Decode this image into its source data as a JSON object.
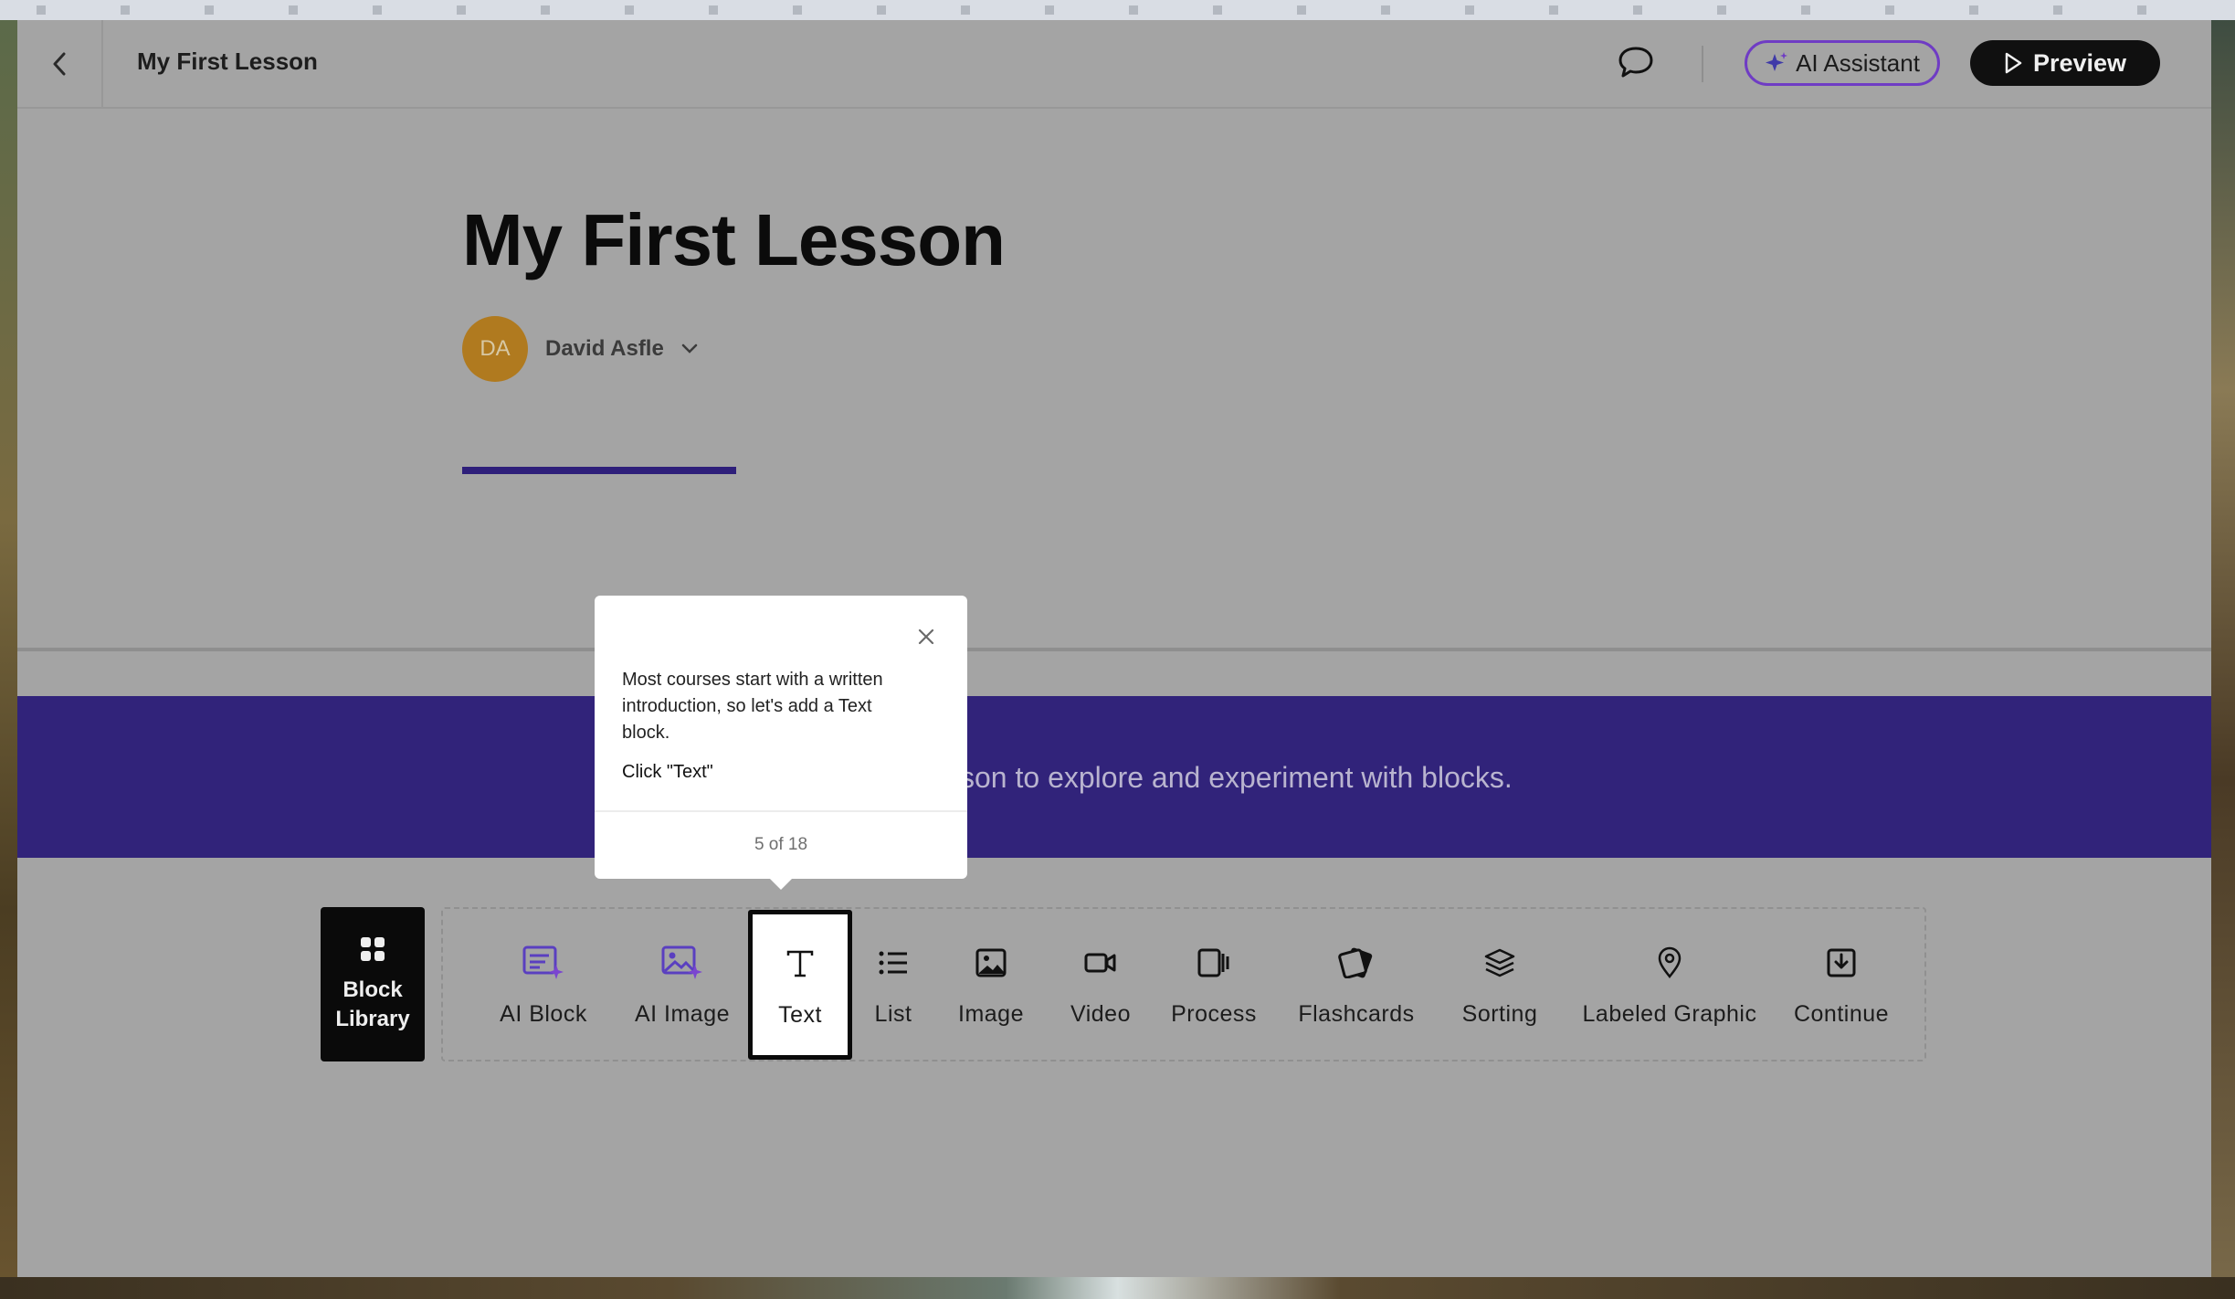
{
  "header": {
    "title": "My First Lesson",
    "ai_assistant_label": "AI Assistant",
    "preview_label": "Preview"
  },
  "lesson": {
    "title": "My First Lesson",
    "author_initials": "DA",
    "author_name": "David Asfle"
  },
  "banner": {
    "text": "son to explore and experiment with blocks."
  },
  "block_library": {
    "label": "Block Library"
  },
  "blocks": [
    {
      "label": "AI Block",
      "icon": "ai-block-icon"
    },
    {
      "label": "AI Image",
      "icon": "ai-image-icon"
    },
    {
      "label": "Text",
      "icon": "text-icon"
    },
    {
      "label": "List",
      "icon": "list-icon"
    },
    {
      "label": "Image",
      "icon": "image-icon"
    },
    {
      "label": "Video",
      "icon": "video-icon"
    },
    {
      "label": "Process",
      "icon": "process-icon"
    },
    {
      "label": "Flashcards",
      "icon": "flashcards-icon"
    },
    {
      "label": "Sorting",
      "icon": "sorting-icon"
    },
    {
      "label": "Labeled Graphic",
      "icon": "labeled-graphic-icon"
    },
    {
      "label": "Continue",
      "icon": "continue-icon"
    }
  ],
  "tooltip": {
    "body": "Most courses start with a written introduction, so let's add a Text block.",
    "cta": "Click \"Text\"",
    "step": "5 of 18"
  },
  "colors": {
    "accent": "#31237a",
    "ai_purple": "#6f3cc4",
    "avatar": "#b07a1f"
  }
}
